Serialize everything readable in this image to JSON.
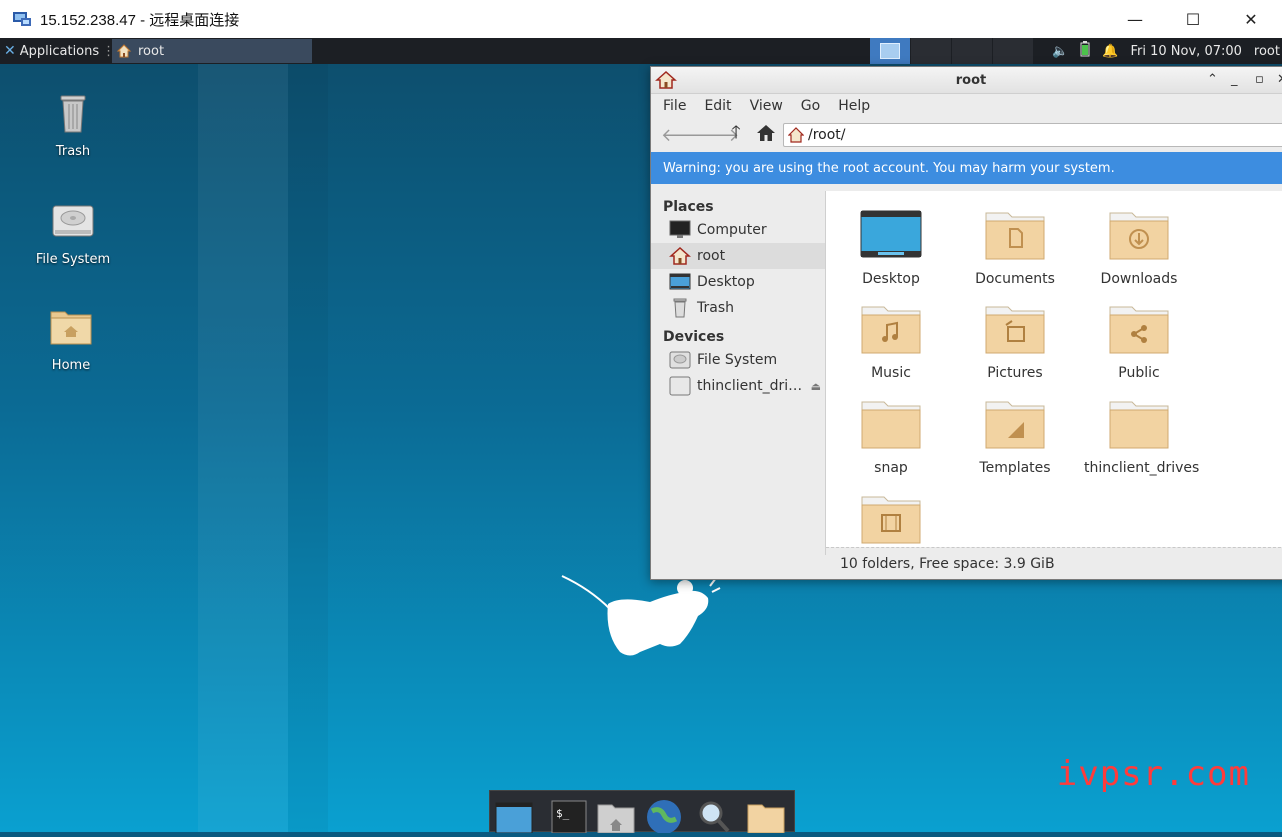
{
  "rdp": {
    "title": "15.152.238.47 - 远程桌面连接",
    "minimize": "—",
    "maximize": "☐",
    "close": "✕"
  },
  "panel": {
    "applications": "Applications",
    "task_label": "root",
    "clock": "Fri 10 Nov, 07:00",
    "user": "root"
  },
  "desktop": {
    "icons": [
      {
        "label": "Trash"
      },
      {
        "label": "File System"
      },
      {
        "label": "Home"
      }
    ]
  },
  "fm": {
    "title": "root",
    "menu": [
      "File",
      "Edit",
      "View",
      "Go",
      "Help"
    ],
    "path": "/root/",
    "warning": "Warning: you are using the root account. You may harm your system.",
    "sidebar": {
      "places_header": "Places",
      "places": [
        "Computer",
        "root",
        "Desktop",
        "Trash"
      ],
      "devices_header": "Devices",
      "devices": [
        "File System",
        "thinclient_dri…"
      ]
    },
    "items": [
      "Desktop",
      "Documents",
      "Downloads",
      "Music",
      "Pictures",
      "Public",
      "snap",
      "Templates",
      "thinclient_drives"
    ],
    "status": "10 folders, Free space: 3.9 GiB"
  },
  "watermark": "ivpsr.com"
}
